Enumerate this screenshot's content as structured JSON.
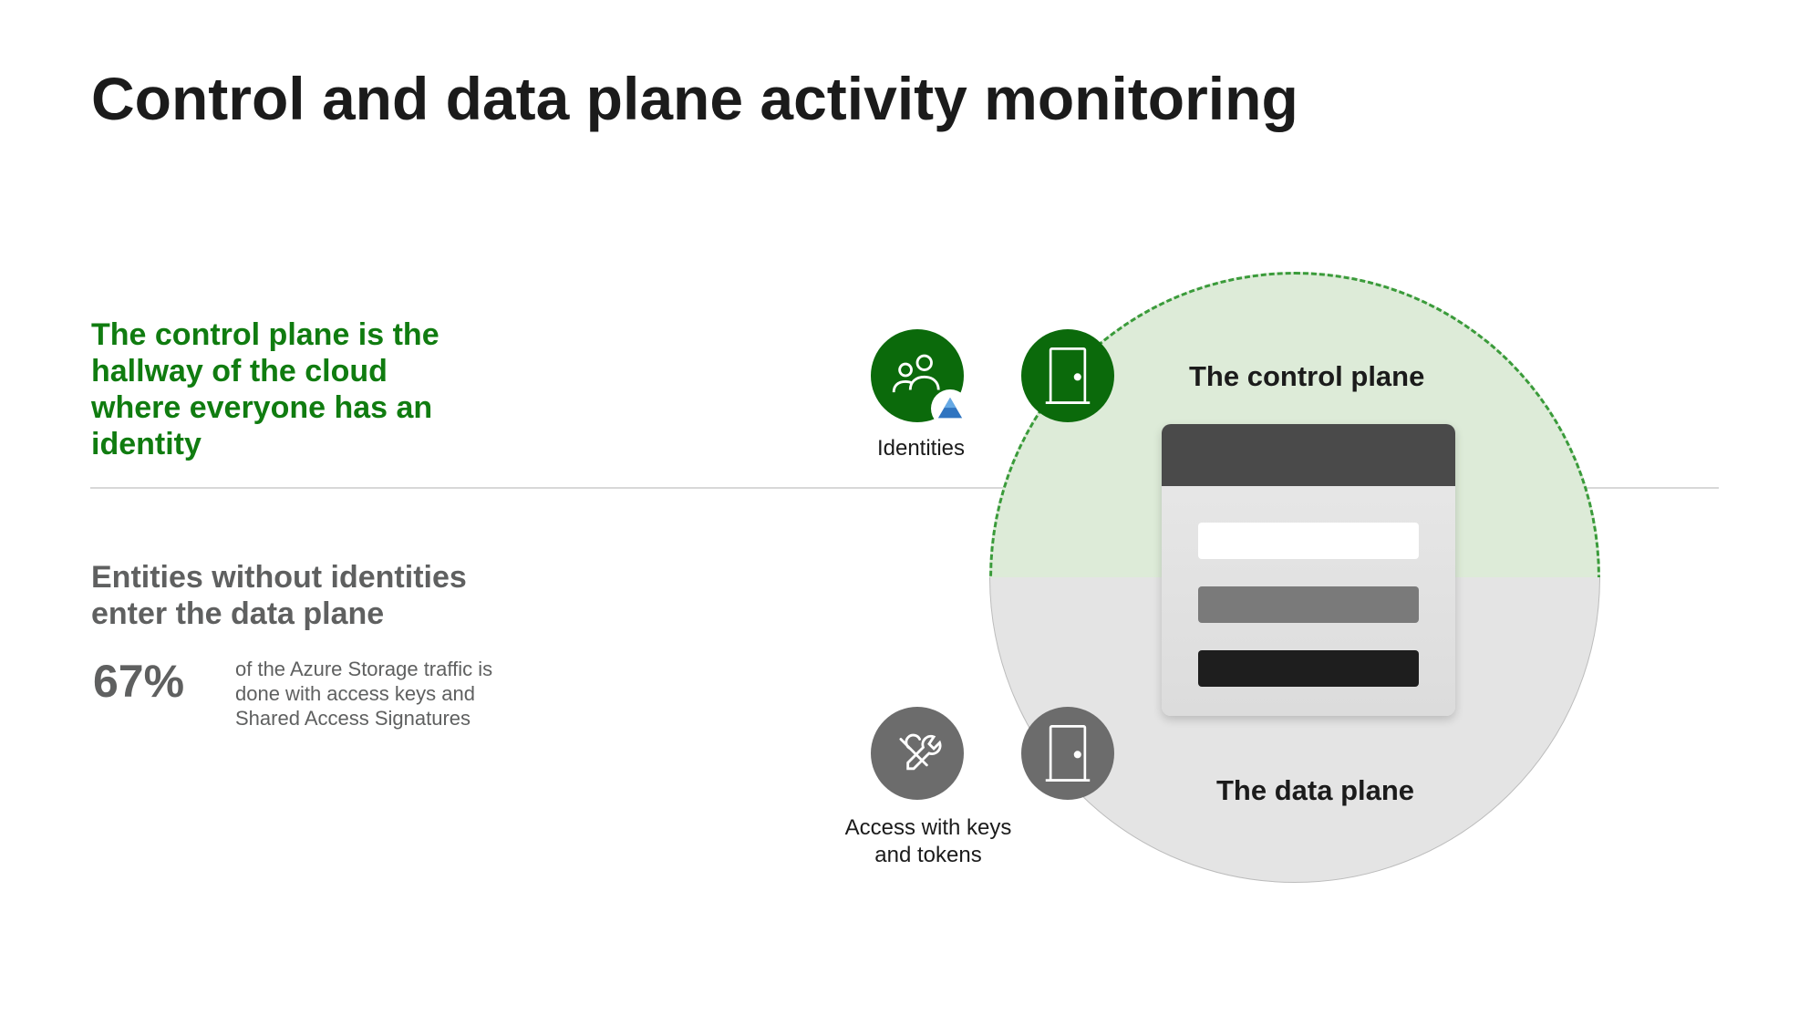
{
  "title": "Control and data plane activity monitoring",
  "control_plane": {
    "description": "The control plane is the hallway of the cloud where everyone has an identity",
    "label": "The control plane",
    "identities_label": "Identities"
  },
  "data_plane": {
    "description": "Entities without identities enter the data plane",
    "label": "The data plane",
    "stat_percent": "67%",
    "stat_description": "of the Azure Storage traffic is done with access keys and Shared Access Signatures",
    "access_label": "Access with keys and tokens"
  },
  "icons": {
    "identities": "people-icon",
    "azure_ad": "azure-ad-icon",
    "door": "door-icon",
    "keys": "key-wrench-icon"
  },
  "colors": {
    "accent_green": "#107c10",
    "text_gray": "#5f6060",
    "circle_green_fill": "#ddebd8",
    "circle_gray_fill": "#e4e4e4"
  }
}
